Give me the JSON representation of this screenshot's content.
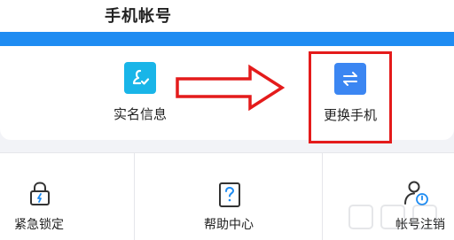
{
  "header": {
    "title": "手机帐号"
  },
  "main": {
    "features": [
      {
        "label": "实名信息",
        "icon": "real-name-icon"
      },
      {
        "label": "更换手机",
        "icon": "change-phone-icon"
      }
    ]
  },
  "grid": {
    "items": [
      {
        "label": "紧急锁定",
        "icon": "lock-icon"
      },
      {
        "label": "帮助中心",
        "icon": "help-icon"
      },
      {
        "label": "帐号注销",
        "icon": "account-cancel-icon"
      }
    ]
  },
  "colors": {
    "accent_blue": "#1f8cf2",
    "real_name_tile": "#19b5e8",
    "change_phone_tile": "#3b86f2",
    "annotation_red": "#e41b1b"
  }
}
